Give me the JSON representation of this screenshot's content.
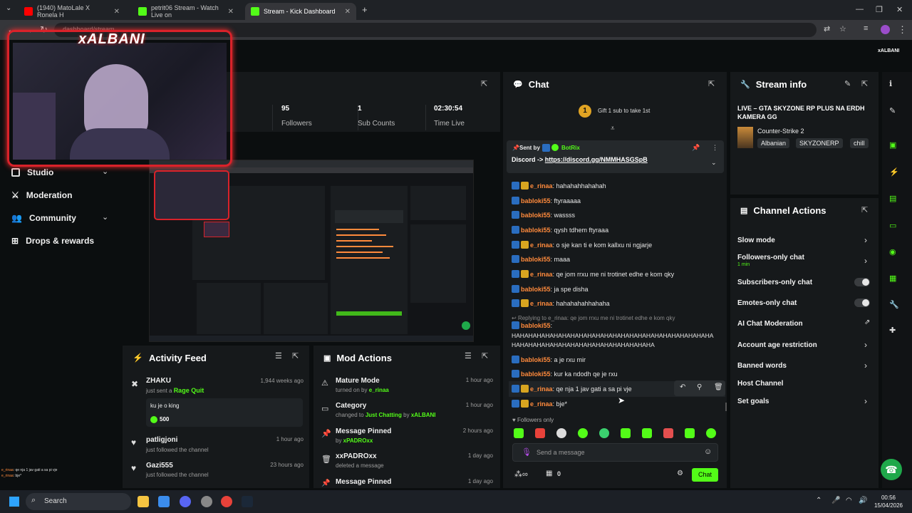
{
  "browser": {
    "tabs": [
      {
        "label": "(1940) MatoLale X Ronela H",
        "fav_color": "#ff0000"
      },
      {
        "label": "petrit06 Stream - Watch Live on",
        "fav_color": "#53fc18"
      },
      {
        "label": "Stream - Kick Dashboard",
        "fav_color": "#53fc18"
      }
    ],
    "url": "dashboard/stream"
  },
  "overlay": {
    "brand": "xALBANI"
  },
  "stats": [
    {
      "value": "95",
      "label": "Followers"
    },
    {
      "value": "1",
      "label": "Sub Counts"
    },
    {
      "value": "02:30:54",
      "label": "Time Live"
    }
  ],
  "nav": {
    "items": [
      {
        "label": "Studio"
      },
      {
        "label": "Moderation"
      },
      {
        "label": "Community"
      },
      {
        "label": "Drops & rewards"
      }
    ]
  },
  "chat": {
    "title": "Chat",
    "gift_text": "Gift 1 sub to take 1st",
    "gift_rank": "1",
    "pinned": {
      "sent_by": "Sent by",
      "bot": "BotRix",
      "prefix": "Discord -> ",
      "link": "https://discord.gg/NMMHASGSpB"
    },
    "messages": [
      {
        "user": "e_rinaa",
        "color": "orange",
        "gold": true,
        "text": "hahahahhahahah"
      },
      {
        "user": "babloki55",
        "color": "orange",
        "gold": false,
        "text": "ftyraaaaa"
      },
      {
        "user": "babloki55",
        "color": "orange",
        "gold": false,
        "text": "wassss"
      },
      {
        "user": "babloki55",
        "color": "orange",
        "gold": false,
        "text": "qysh tdhem ftyraaa"
      },
      {
        "user": "e_rinaa",
        "color": "orange",
        "gold": true,
        "text": "o sje kan ti e kom kallxu ni ngjarje"
      },
      {
        "user": "babloki55",
        "color": "orange",
        "gold": false,
        "text": "maaa"
      },
      {
        "user": "e_rinaa",
        "color": "orange",
        "gold": true,
        "text": "qe jom rrxu me ni trotinet edhe e kom qky"
      },
      {
        "user": "babloki55",
        "color": "orange",
        "gold": false,
        "text": "ja spe disha"
      },
      {
        "user": "e_rinaa",
        "color": "orange",
        "gold": true,
        "text": "hahahahahhahaha"
      }
    ],
    "reply_to": "Replying to e_rinaa: qe jom rrxu me ni trotinet edhe e kom qky",
    "reply_user": "babloki55",
    "reply_text_1": "HAHAHAHAHAHAHAHAHAHAHAHAHAHAHAHAHAHAHAHAHAHAHAHA",
    "reply_text_2": "HAHAHAHAHAHAHAHAHAHAHAHAHAHAHAHAHA",
    "messages2": [
      {
        "user": "babloki55",
        "gold": false,
        "text": "a je rxu mir"
      },
      {
        "user": "babloki55",
        "gold": false,
        "text": "kur ka ndodh qe je rxu"
      },
      {
        "user": "e_rinaa",
        "gold": true,
        "text": "qe nja 1 jav gati a sa pi vje"
      },
      {
        "user": "e_rinaa",
        "gold": true,
        "text": "bje*"
      }
    ],
    "mode": "Followers only",
    "placeholder": "Send a message",
    "points": "0",
    "send_label": "Chat"
  },
  "stream_info": {
    "title": "Stream info",
    "stream_title": "LIVE – GTA SKYZONE RP PLUS NA ERDH KAMERA GG",
    "category": "Counter-Strike 2",
    "tags": [
      "Albanian",
      "SKYZONERP",
      "chill"
    ]
  },
  "channel_actions": {
    "title": "Channel Actions",
    "slow": "Slow mode",
    "followers_only": "Followers-only chat",
    "followers_only_sub": "1 min",
    "subs_only": "Subscribers-only chat",
    "emotes_only": "Emotes-only chat",
    "ai": "AI Chat Moderation",
    "age": "Account age restriction",
    "banned": "Banned words",
    "host": "Host Channel",
    "goals": "Set goals"
  },
  "activity": {
    "title": "Activity Feed",
    "items": [
      {
        "user": "ZHAKU",
        "action": "just sent a ",
        "highlight": "Rage Quit",
        "time": "1,944 weeks ago",
        "message": "ku je o king",
        "amount": "500"
      },
      {
        "user": "patligjoni",
        "action": "just followed the channel",
        "time": "1 hour ago"
      },
      {
        "user": "Gazi555",
        "action": "just followed the channel",
        "time": "23 hours ago"
      }
    ]
  },
  "mod_actions": {
    "title": "Mod Actions",
    "items": [
      {
        "title": "Mature Mode",
        "pre": "turned on by ",
        "user": "e_rinaa",
        "mid": "",
        "user2": "",
        "time": "1 hour ago"
      },
      {
        "title": "Category",
        "pre": "changed to ",
        "user": "Just Chatting",
        "mid": " by ",
        "user2": "xALBANI",
        "time": "1 hour ago"
      },
      {
        "title": "Message Pinned",
        "pre": "by ",
        "user": "xPADROxx",
        "mid": "",
        "user2": "",
        "time": "2 hours ago"
      },
      {
        "title": "xxPADROxx",
        "pre": "deleted a message",
        "user": "",
        "mid": "",
        "user2": "",
        "time": "1 day ago"
      },
      {
        "title": "Message Pinned",
        "pre": "",
        "user": "",
        "mid": "",
        "user2": "",
        "time": "1 day ago"
      }
    ]
  },
  "stream_overlay_chat": [
    {
      "user": "e_rinaa",
      "text": "qe nja 1 jav gati a sa pi vje"
    },
    {
      "user": "e_rinaa",
      "text": "bje*"
    }
  ],
  "taskbar": {
    "search": "Search",
    "time": "00:56",
    "date": "15/04/2026"
  }
}
